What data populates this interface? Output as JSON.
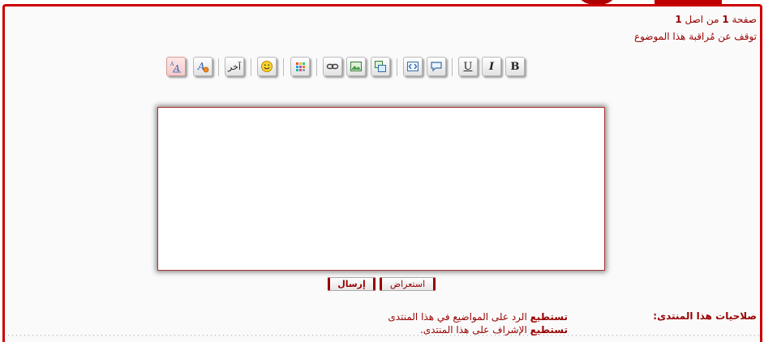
{
  "pagination": {
    "prefix": "صفحة",
    "current_page": "1",
    "middle": "من اصل",
    "total_pages": "1"
  },
  "watch_topic_link": "توقف عن مُراقبة هذا الموضوع",
  "toolbar": {
    "buttons": [
      {
        "name": "bold-button",
        "icon": "bold-icon",
        "glyph": "B"
      },
      {
        "name": "italic-button",
        "icon": "italic-icon",
        "glyph": "I"
      },
      {
        "name": "underline-button",
        "icon": "underline-icon",
        "glyph": "U"
      },
      {
        "name": "quote-button",
        "icon": "speech-bubble-icon"
      },
      {
        "name": "code-button",
        "icon": "code-icon"
      },
      {
        "name": "image-gallery-button",
        "icon": "multi-image-icon"
      },
      {
        "name": "insert-image-button",
        "icon": "image-icon"
      },
      {
        "name": "insert-link-button",
        "icon": "link-icon"
      },
      {
        "name": "colors-button",
        "icon": "color-grid-icon"
      },
      {
        "name": "smilies-button",
        "icon": "smiley-icon"
      },
      {
        "name": "other-button",
        "label": "آخر"
      },
      {
        "name": "clear-format-button",
        "icon": "remove-format-icon"
      },
      {
        "name": "font-size-button",
        "icon": "font-size-icon"
      }
    ]
  },
  "editor": {
    "value": ""
  },
  "buttons": {
    "submit_label": "إرسال",
    "preview_label": "استعراض"
  },
  "permissions": {
    "title": "صلاحيات هذا المنتدى:",
    "lines": [
      {
        "bold": "تستطيع",
        "text": " الرد على المواضيع في هذا المنتدى"
      },
      {
        "bold": "تستطيع",
        "text": " الإشراف على هذا المنتدى."
      }
    ]
  },
  "colors": {
    "accent": "#cc0000",
    "text": "#990000",
    "background": "#fafafa"
  }
}
